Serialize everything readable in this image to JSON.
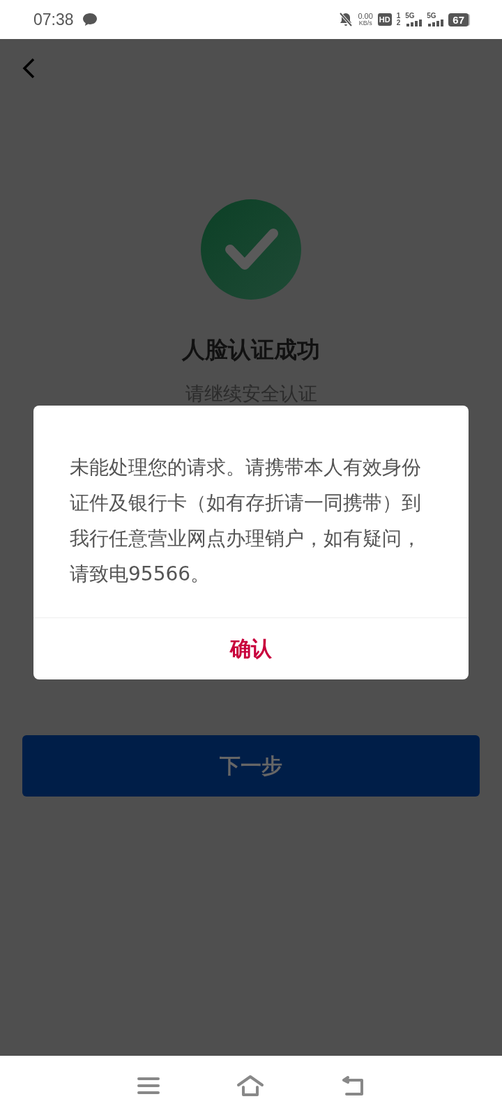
{
  "status_bar": {
    "time": "07:38",
    "network_speed": {
      "value": "0.00",
      "unit": "KB/s"
    },
    "hd_label": "HD",
    "sim_slots": [
      "1",
      "2"
    ],
    "signals": [
      {
        "label": "5G"
      },
      {
        "label": "5G"
      }
    ],
    "battery": "67"
  },
  "page": {
    "title": "人脸认证成功",
    "subtitle": "请继续安全认证",
    "next_button": "下一步"
  },
  "dialog": {
    "message": "未能处理您的请求。请携带本人有效身份证件及银行卡（如有存折请一同携带）到我行任意营业网点办理销户，如有疑问，请致电95566。",
    "confirm_label": "确认"
  }
}
